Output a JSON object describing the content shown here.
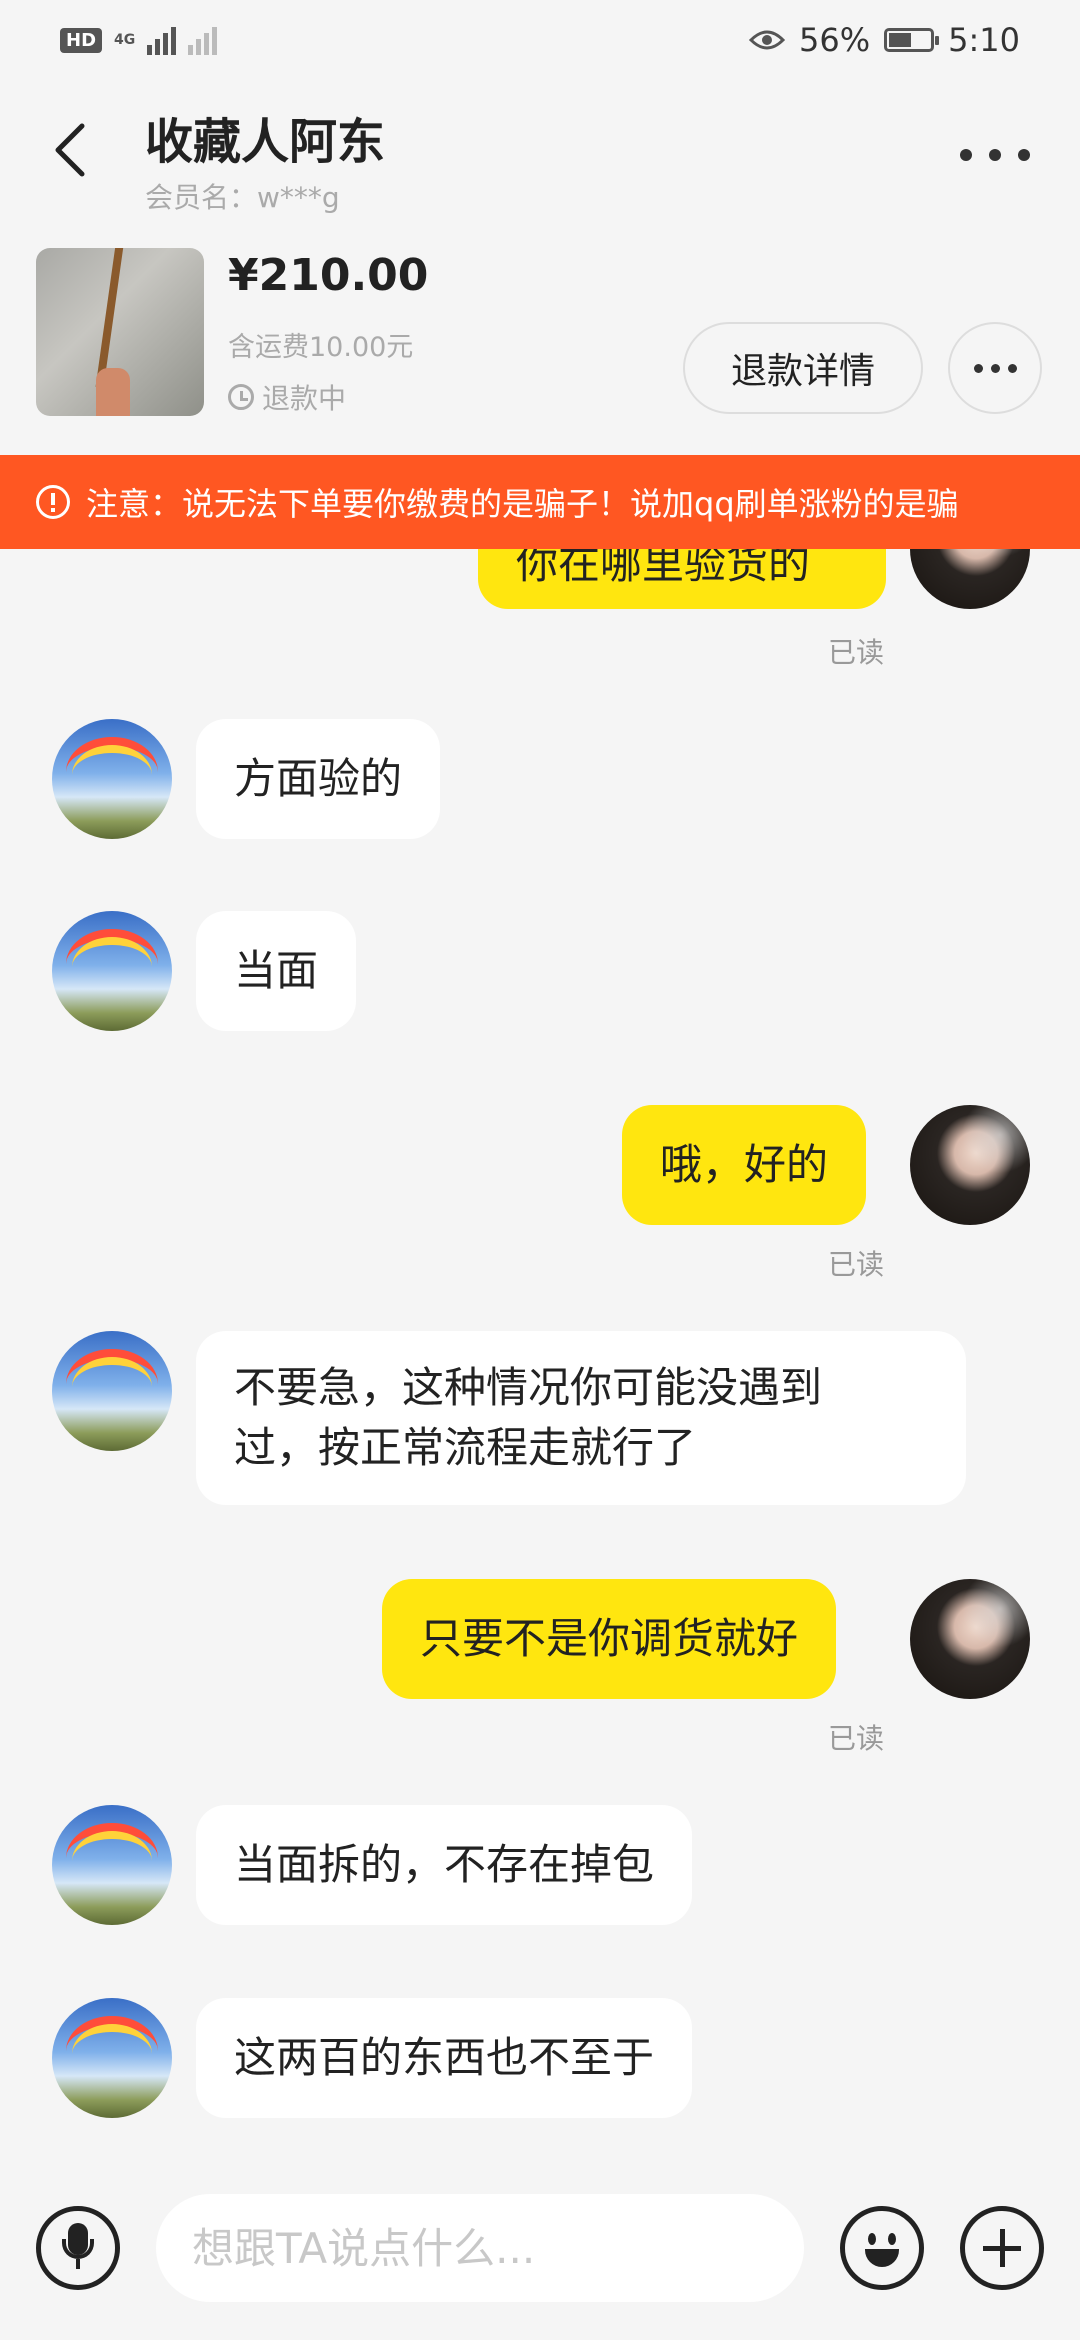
{
  "status_bar": {
    "hd_label": "HD",
    "network": "4G",
    "eye_percent": "56%",
    "battery_level": 0.56,
    "time": "5:10"
  },
  "header": {
    "title": "收藏人阿东",
    "subtitle": "会员名：w***g"
  },
  "product": {
    "price": "¥210.00",
    "shipping": "含运费10.00元",
    "status": "退款中",
    "refund_button": "退款详情"
  },
  "warning": {
    "text": "注意：说无法下单要你缴费的是骗子！说加qq刷单涨粉的是骗"
  },
  "messages": [
    {
      "from": "me",
      "text": "你在哪里验货的",
      "read": "已读"
    },
    {
      "from": "them",
      "text": "方面验的"
    },
    {
      "from": "them",
      "text": "当面"
    },
    {
      "from": "me",
      "text": "哦，好的",
      "read": "已读"
    },
    {
      "from": "them",
      "text": "不要急，这种情况你可能没遇到过，按正常流程走就行了"
    },
    {
      "from": "me",
      "text": "只要不是你调货就好",
      "read": "已读"
    },
    {
      "from": "them",
      "text": "当面拆的，不存在掉包"
    },
    {
      "from": "them",
      "text": "这两百的东西也不至于"
    }
  ],
  "message_lines": {
    "m4_line1": "不要急，这种情况你可能没遇到",
    "m4_line2": "过，按正常流程走就行了"
  },
  "input": {
    "placeholder": "想跟TA说点什么..."
  },
  "icons": {
    "back": "chevron-left-icon",
    "more": "more-horizontal-icon",
    "clock": "clock-icon",
    "warning": "alert-circle-icon",
    "voice": "microphone-icon",
    "emoji": "emoji-icon",
    "plus": "plus-icon"
  },
  "colors": {
    "my_bubble": "#ffe60f",
    "their_bubble": "#ffffff",
    "warning_banner": "#ff5722",
    "background": "#f5f5f5"
  }
}
